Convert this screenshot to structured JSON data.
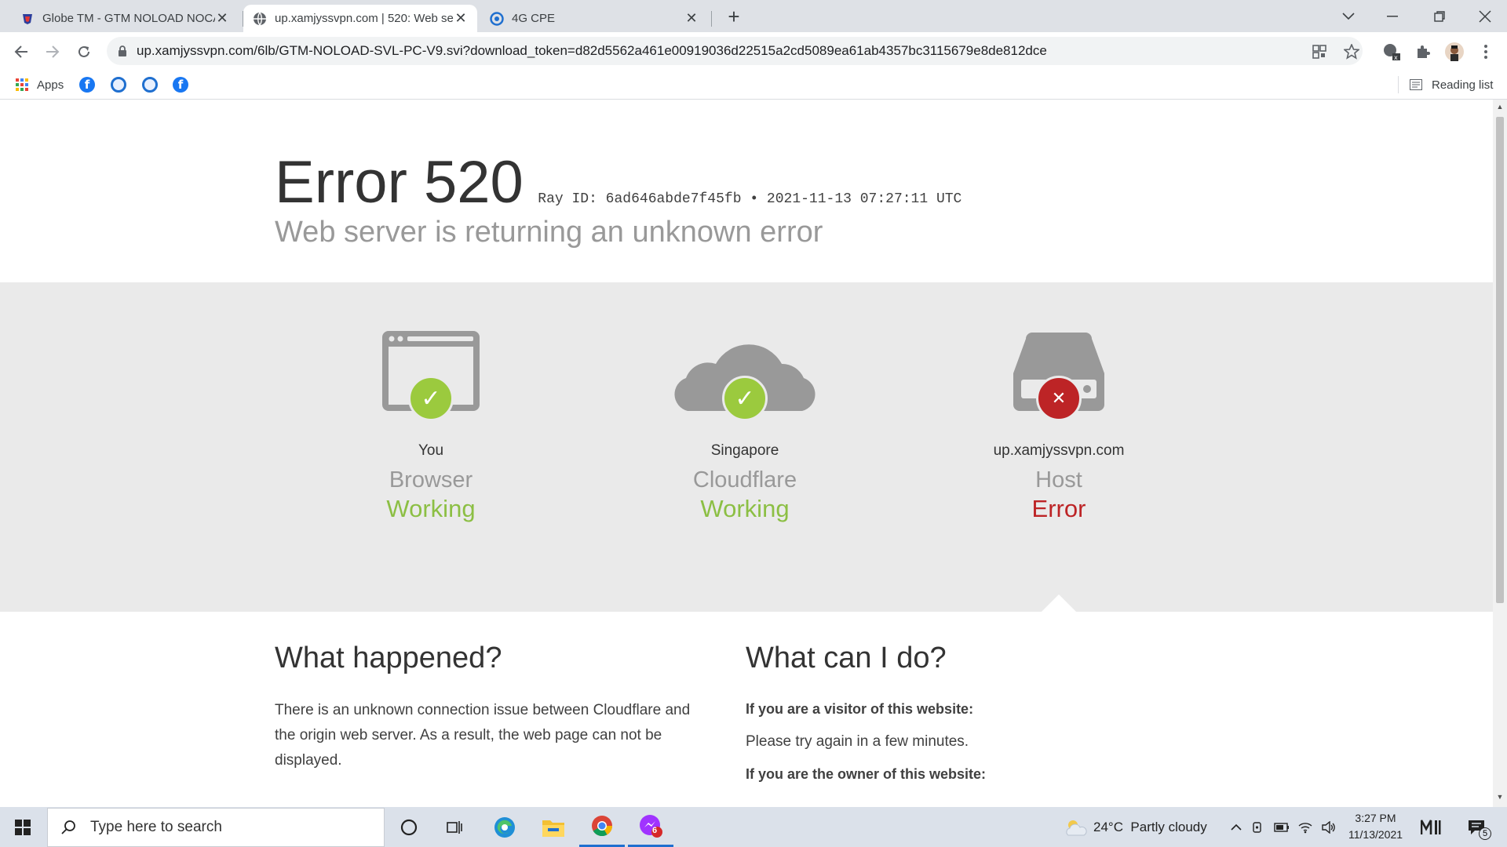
{
  "browser": {
    "tabs": [
      {
        "title": "Globe TM - GTM NOLOAD NOCA",
        "active": false
      },
      {
        "title": "up.xamjyssvpn.com | 520: Web se",
        "active": true
      },
      {
        "title": "4G CPE",
        "active": false
      }
    ],
    "url": "up.xamjyssvpn.com/6lb/GTM-NOLOAD-SVL-PC-V9.svi?download_token=d82d5562a461e00919036d22515a2cd5089ea61ab4357bc3115679e8de812dce",
    "bookmarks": {
      "apps_label": "Apps"
    },
    "reading_list_label": "Reading list"
  },
  "error": {
    "code": "Error 520",
    "ray": "Ray ID: 6ad646abde7f45fb",
    "timestamp": "2021-11-13 07:27:11 UTC",
    "subtitle": "Web server is returning an unknown error"
  },
  "status": [
    {
      "location": "You",
      "name": "Browser",
      "status": "Working",
      "ok": true
    },
    {
      "location": "Singapore",
      "name": "Cloudflare",
      "status": "Working",
      "ok": true
    },
    {
      "location": "up.xamjyssvpn.com",
      "name": "Host",
      "status": "Error",
      "ok": false
    }
  ],
  "info": {
    "what_happened_title": "What happened?",
    "what_happened_text": "There is an unknown connection issue between Cloudflare and the origin web server. As a result, the web page can not be displayed.",
    "what_can_i_do_title": "What can I do?",
    "visitor_heading": "If you are a visitor of this website:",
    "visitor_text": "Please try again in a few minutes.",
    "owner_heading": "If you are the owner of this website:"
  },
  "taskbar": {
    "search_placeholder": "Type here to search",
    "weather": "24°C  Partly cloudy",
    "time": "3:27 PM",
    "date": "11/13/2021",
    "notifications_count": "5",
    "mail_badge": "6"
  },
  "colors": {
    "ok": "#8cbf44",
    "error": "#bd2426",
    "band": "#eaeaea"
  }
}
